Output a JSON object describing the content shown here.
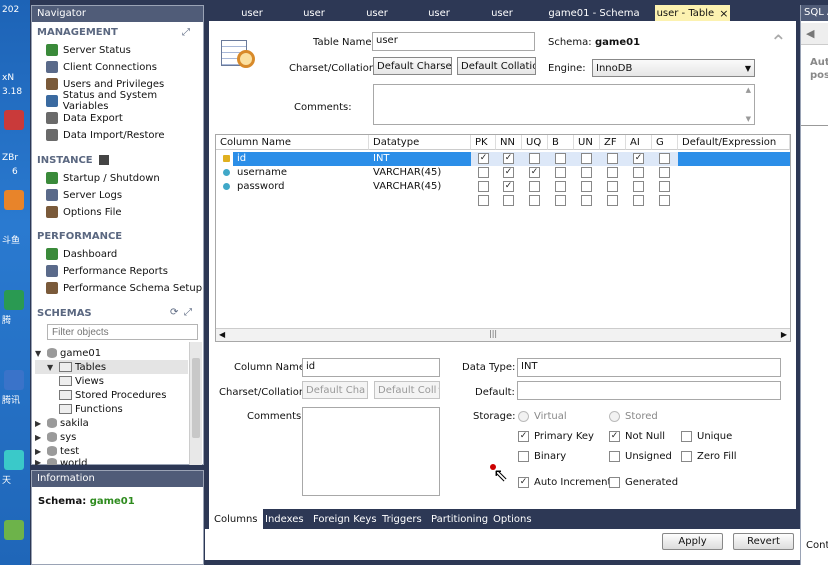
{
  "desktop": {
    "top_text": "202",
    "x_text": "xN",
    "t_text": "3.18",
    "z_text": "ZBr",
    "six": "6",
    "dou": "斗鱼",
    "jing": "腾",
    "teng": "腾讯",
    "tian": "天"
  },
  "navigator": {
    "title": "Navigator",
    "management_header": "MANAGEMENT",
    "management_items": [
      "Server Status",
      "Client Connections",
      "Users and Privileges",
      "Status and System Variables",
      "Data Export",
      "Data Import/Restore"
    ],
    "instance_header": "INSTANCE",
    "instance_items": [
      "Startup / Shutdown",
      "Server Logs",
      "Options File"
    ],
    "performance_header": "PERFORMANCE",
    "performance_items": [
      "Dashboard",
      "Performance Reports",
      "Performance Schema Setup"
    ],
    "schemas_header": "SCHEMAS",
    "filter_placeholder": "Filter objects",
    "tree": {
      "db": "game01",
      "children": [
        "Tables",
        "Views",
        "Stored Procedures",
        "Functions"
      ],
      "other": [
        "sakila",
        "sys",
        "test",
        "world"
      ]
    }
  },
  "information": {
    "title": "Information",
    "schema_label": "Schema:",
    "schema_value": "game01"
  },
  "tabs": [
    "user",
    "user",
    "user",
    "user",
    "user",
    "game01 - Schema",
    "user - Table"
  ],
  "tab_close": "×",
  "right_panel": {
    "title": "SQL A",
    "line1": "Aut",
    "line2": "pos",
    "bottom": "Cont"
  },
  "editor": {
    "table_name_label": "Table Name:",
    "table_name": "user",
    "schema_label": "Schema:",
    "schema_value": "game01",
    "charset_label": "Charset/Collation:",
    "charset": "Default Charse",
    "collation": "Default Collatio",
    "engine_label": "Engine:",
    "engine": "InnoDB",
    "comments_label": "Comments:",
    "collapse_icon": "⌃"
  },
  "grid": {
    "headers": [
      "Column Name",
      "Datatype",
      "PK",
      "NN",
      "UQ",
      "B",
      "UN",
      "ZF",
      "AI",
      "G",
      "Default/Expression"
    ],
    "rows": [
      {
        "name": "id",
        "type": "INT",
        "flags": [
          true,
          true,
          false,
          false,
          false,
          false,
          true,
          false
        ],
        "key": "pk"
      },
      {
        "name": "username",
        "type": "VARCHAR(45)",
        "flags": [
          false,
          true,
          true,
          false,
          false,
          false,
          false,
          false
        ],
        "key": "col"
      },
      {
        "name": "password",
        "type": "VARCHAR(45)",
        "flags": [
          false,
          true,
          false,
          false,
          false,
          false,
          false,
          false
        ],
        "key": "col"
      },
      {
        "name": "",
        "type": "",
        "flags": [
          false,
          false,
          false,
          false,
          false,
          false,
          false,
          false
        ],
        "key": "none"
      }
    ],
    "scroll_handle": "|||"
  },
  "details": {
    "column_name_label": "Column Name:",
    "column_name": "id",
    "data_type_label": "Data Type:",
    "data_type": "INT",
    "charset_label": "Charset/Collation:",
    "charset": "Default Cha",
    "collation": "Default Coll",
    "default_label": "Default:",
    "default_value": "",
    "comments_label": "Comments:",
    "storage_label": "Storage:",
    "virtual": "Virtual",
    "stored": "Stored",
    "options": [
      {
        "label": "Primary Key",
        "checked": true
      },
      {
        "label": "Not Null",
        "checked": true
      },
      {
        "label": "Unique",
        "checked": false
      },
      {
        "label": "Binary",
        "checked": false
      },
      {
        "label": "Unsigned",
        "checked": false
      },
      {
        "label": "Zero Fill",
        "checked": false
      },
      {
        "label": "Auto Increment",
        "checked": true
      },
      {
        "label": "Generated",
        "checked": false
      }
    ]
  },
  "bottom_tabs": [
    "Columns",
    "Indexes",
    "Foreign Keys",
    "Triggers",
    "Partitioning",
    "Options"
  ],
  "buttons": {
    "apply": "Apply",
    "revert": "Revert"
  },
  "colors": {
    "accent": "#2b8ee8",
    "dark_bg": "#2d3855",
    "header": "#505c78",
    "active_tab": "#fcf2b0",
    "schema_green": "#2e8b1e"
  }
}
